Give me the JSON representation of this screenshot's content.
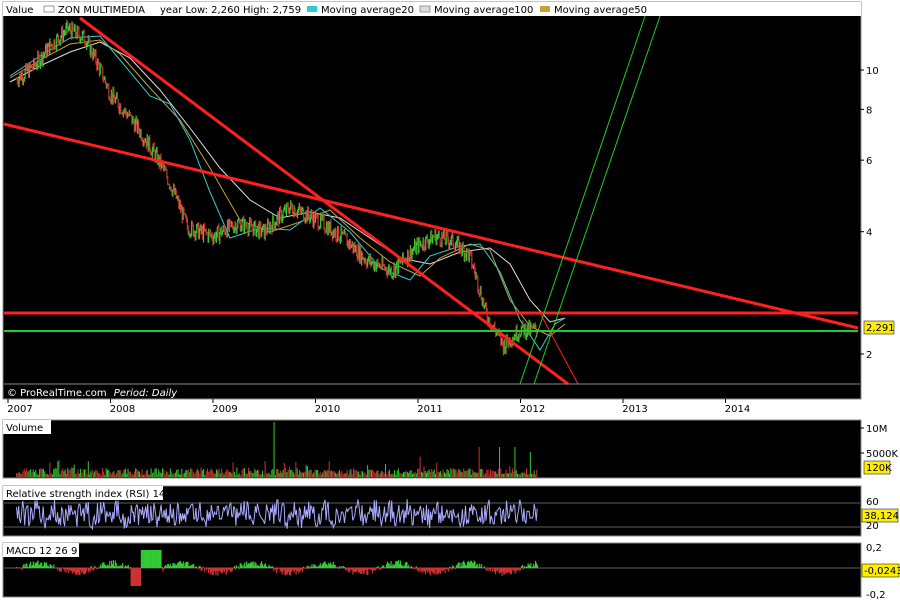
{
  "main": {
    "legend": {
      "value_label": "Value",
      "instrument": "ZON MULTIMEDIA",
      "year_range": "year Low: 2,260 High: 2,759",
      "ma20": "Moving average20",
      "ma100": "Moving average100",
      "ma50": "Moving average50"
    },
    "watermark": "© ProRealTime.com",
    "period": "Period: Daily",
    "last_value": "2,291",
    "colors": {
      "price_up": "#33cc33",
      "price_down": "#cc3333",
      "ma20": "#33cccc",
      "ma100": "#dddddd",
      "ma50": "#c8a03c",
      "trend_red": "#ff2020",
      "trend_green": "#22cc22",
      "background": "#000000"
    }
  },
  "volume": {
    "label": "Volume",
    "last_value": "120K"
  },
  "rsi": {
    "label": "Relative strength index (RSI) 14",
    "last_value": "38,124"
  },
  "macd": {
    "label": "MACD 12 26 9",
    "last_value": "-0,0243"
  },
  "chart_data": [
    {
      "type": "line",
      "x": [
        "2007-02",
        "2007-04",
        "2007-06",
        "2007-08",
        "2007-10",
        "2008-01",
        "2008-04",
        "2008-07",
        "2008-10",
        "2009-01",
        "2009-04",
        "2009-07",
        "2009-10",
        "2010-01",
        "2010-04",
        "2010-07",
        "2010-10",
        "2011-01",
        "2011-03",
        "2011-05",
        "2011-07",
        "2011-09",
        "2011-11",
        "2012-01",
        "2012-03"
      ],
      "series": [
        {
          "name": "ZON MULTIMEDIA",
          "values": [
            9.5,
            10.2,
            11.5,
            12.6,
            12.0,
            8.7,
            7.3,
            5.8,
            4.1,
            3.9,
            4.2,
            4.0,
            4.6,
            4.3,
            3.9,
            3.4,
            3.2,
            3.7,
            3.9,
            3.8,
            3.5,
            2.5,
            2.1,
            2.3,
            2.29
          ]
        }
      ],
      "yticks": [
        "2",
        "4",
        "6",
        "8",
        "10"
      ],
      "xticks": [
        "2007",
        "2008",
        "2009",
        "2010",
        "2011",
        "2012",
        "2013",
        "2014"
      ],
      "log_scale": true,
      "title": "ZON MULTIMEDIA"
    },
    {
      "type": "bar",
      "title": "Volume",
      "yticks": [
        "5000K",
        "10M"
      ]
    },
    {
      "type": "line",
      "title": "Relative strength index (RSI) 14",
      "yticks": [
        "20",
        "60"
      ]
    },
    {
      "type": "bar",
      "title": "MACD 12 26 9",
      "yticks": [
        "0,2",
        "-0,2"
      ]
    }
  ]
}
